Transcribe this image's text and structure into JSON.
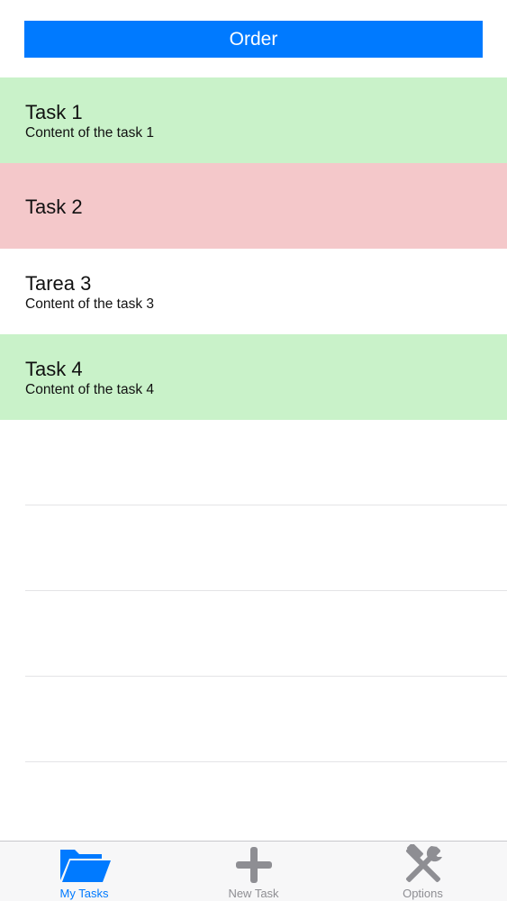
{
  "toolbar": {
    "order_label": "Order",
    "order_color": "#007aff"
  },
  "tasks": [
    {
      "title": "Task 1",
      "content": "Content of the task 1",
      "background": "#c9f2c9"
    },
    {
      "title": "Task 2",
      "content": "",
      "background": "#f4c8ca"
    },
    {
      "title": "Tarea 3",
      "content": "Content of the task 3",
      "background": "#ffffff"
    },
    {
      "title": "Task 4",
      "content": "Content of the task 4",
      "background": "#c9f2c9"
    }
  ],
  "tab_bar": {
    "items": [
      {
        "label": "My Tasks",
        "icon": "folder-icon",
        "selected": true,
        "color": "#007aff"
      },
      {
        "label": "New Task",
        "icon": "plus-icon",
        "selected": false,
        "color": "#8e8e93"
      },
      {
        "label": "Options",
        "icon": "tools-icon",
        "selected": false,
        "color": "#8e8e93"
      }
    ]
  }
}
